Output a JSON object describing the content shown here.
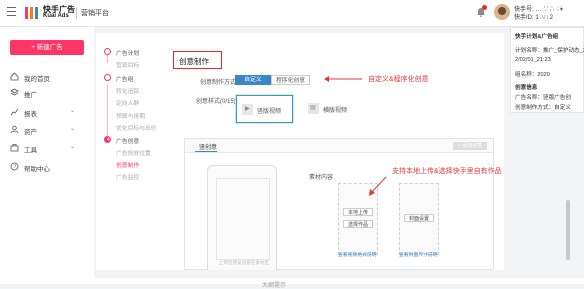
{
  "header": {
    "brand_cn": "快手广告",
    "brand_en": "Kuai Ads",
    "platform": "营销平台",
    "user_line1": "快手号: … ∵∴ ∷",
    "user_line2": "快手ID: 1 ∴∷ 2"
  },
  "sidebar": {
    "create_label": "+ 新建广告",
    "items": [
      {
        "label": "我的首页"
      },
      {
        "label": "推广"
      },
      {
        "label": "报表"
      },
      {
        "label": "资产"
      },
      {
        "label": "工具"
      },
      {
        "label": "帮助中心"
      }
    ]
  },
  "steps": [
    {
      "label": "广告计划",
      "kind": "title"
    },
    {
      "label": "营销目标",
      "kind": "sub"
    },
    {
      "label": "广告组",
      "kind": "title"
    },
    {
      "label": "转化追踪",
      "kind": "sub"
    },
    {
      "label": "定向人群",
      "kind": "sub"
    },
    {
      "label": "预算与排期",
      "kind": "sub"
    },
    {
      "label": "优化目标与出价",
      "kind": "sub"
    },
    {
      "label": "广告创意",
      "kind": "title"
    },
    {
      "label": "广告投放位置",
      "kind": "sub"
    },
    {
      "label": "创意制作",
      "kind": "active"
    },
    {
      "label": "广告监控",
      "kind": "sub"
    }
  ],
  "section": {
    "title": "创意制作",
    "method_label": "创意制作方式",
    "method_options": [
      "自定义",
      "程序化创意"
    ],
    "format_label": "创意样式(0/15)",
    "formats": [
      "竖版视频",
      "横版视频"
    ]
  },
  "editor": {
    "tab": "竖创意",
    "add_label": "+ 添加创意",
    "phone_tip": "上传后预览创意在素材区",
    "material_label": "素材内容",
    "upload_btn": "本地上传",
    "select_btn": "选择作品",
    "cover_btn": "封面设置",
    "note_a": "查看视频格式说明",
    "note_b": "查看封面尺寸说明"
  },
  "annotations": {
    "custom": "自定义&程序化创意",
    "upload": "支持本地上传&选择快手里自有作品"
  },
  "info_panel": {
    "title": "快手计划&广告组",
    "plan_name": "计划名称：推广_保护动态_2",
    "date": "2/02/01_21:23",
    "group": "组名称：2020",
    "section2": "创意信息",
    "name": "广告名称：竖版广告创",
    "mode": "创意制作方式：自定义"
  },
  "footer": {
    "text": "大纲提示"
  },
  "colors": {
    "accent": "#fe3666",
    "primary": "#3a86c9",
    "annotation": "#e53935"
  }
}
